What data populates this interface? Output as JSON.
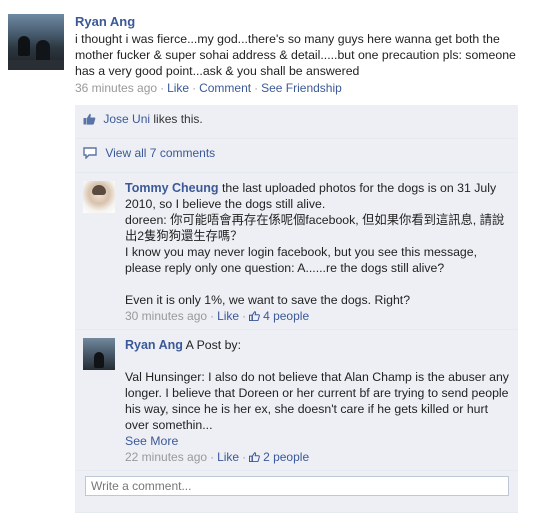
{
  "post": {
    "author": "Ryan Ang",
    "message": "i thought i was fierce...my god...there's so many guys here wanna get both the mother fucker & super sohai address & detail.....but one precaution pls: someone has a very good point...ask & you shall be answered",
    "time": "36 minutes ago",
    "actions": [
      "Like",
      "Comment",
      "See Friendship"
    ]
  },
  "likes": {
    "user": "Jose Uni",
    "suffix": "likes this."
  },
  "view_all": "View all 7 comments",
  "comments": [
    {
      "author": "Tommy Cheung",
      "lines": [
        "the last uploaded photos for the dogs is on 31 July 2010, so I believe the dogs still alive.",
        "doreen: 你可能唔會再存在係呢個facebook, 但如果你看到這訊息, 請說出2隻狗狗還生存嗎？",
        "I know you may never login facebook, but you see this message, please reply only one question: A......re the dogs still alive?",
        "",
        "Even it is only 1%, we want to save the dogs. Right?"
      ],
      "time": "30 minutes ago",
      "like_label": "Like",
      "people": "4 people"
    },
    {
      "author": "Ryan Ang",
      "lines": [
        "A Post by:",
        "",
        "Val Hunsinger: I also do not believe that Alan Champ is the abuser any longer. I believe that Doreen or her current bf are trying to send people his way, since he is her ex, she doesn't care if he gets killed or hurt over somethin..."
      ],
      "see_more": "See More",
      "time": "22 minutes ago",
      "like_label": "Like",
      "people": "2 people"
    }
  ],
  "write_placeholder": "Write a comment...",
  "colors": {
    "link": "#3b5998",
    "ufi_bg": "#edeff4",
    "meta": "#999999"
  },
  "icons": [
    "thumbs-up-icon",
    "comment-bubble-icon"
  ]
}
